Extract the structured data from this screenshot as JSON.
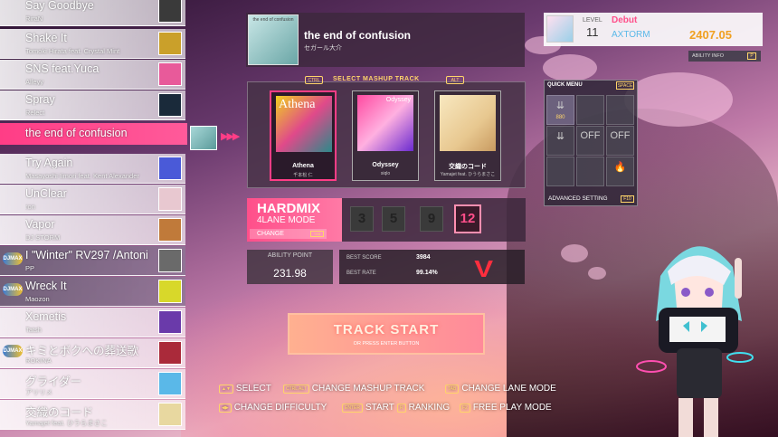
{
  "songs": [
    {
      "title": "Say Goodbye",
      "artist": "RiraN",
      "thumb": "#3a3a3a",
      "badge": ""
    },
    {
      "title": "Shake It",
      "artist": "Tomoki Hirata feat. Crystal Mint",
      "thumb": "#caa02a",
      "badge": ""
    },
    {
      "title": "SNS feat.Yuca",
      "artist": "Alleyy",
      "thumb": "#e85a9a",
      "badge": ""
    },
    {
      "title": "Spray",
      "artist": "Relect",
      "thumb": "#1a2a3a",
      "badge": ""
    },
    {
      "title": "Try Again",
      "artist": "Masayoshi Iimori feat. Kent Alexander",
      "thumb": "#4a5ad8",
      "badge": ""
    },
    {
      "title": "UnClear",
      "artist": "ron",
      "thumb": "#e8c8d0",
      "badge": ""
    },
    {
      "title": "Vapor",
      "artist": "DJ STORM",
      "thumb": "#c07a3a",
      "badge": ""
    },
    {
      "title": "I \"Winter\" RV297 /Antoni",
      "artist": "PP",
      "thumb": "#6a6a6a",
      "badge": "DJMAX"
    },
    {
      "title": "Wreck It",
      "artist": "Maozon",
      "thumb": "#d8d82a",
      "badge": "DJMAX"
    },
    {
      "title": "Xemetis",
      "artist": "Tatsh",
      "thumb": "#6a3aaa",
      "badge": ""
    },
    {
      "title": "キミとボクへの葬送歌",
      "artist": "ROKINA",
      "thumb": "#aa2a3a",
      "badge": "DJMAX"
    },
    {
      "title": "グライダー",
      "artist": "アリリメ",
      "thumb": "#5ab8e8",
      "badge": ""
    },
    {
      "title": "交織のコード",
      "artist": "Yamajet feat. ひうらまさこ",
      "thumb": "#e8d8a0",
      "badge": ""
    }
  ],
  "selected_song": {
    "title": "the end of confusion"
  },
  "top_card": {
    "title": "the end of confusion",
    "artist": "セガール大介",
    "cover_caption": "the end of confusion"
  },
  "mashup": {
    "header": "SELECT MASHUP TRACK",
    "key_left": "CTRL",
    "key_right": "ALT",
    "tracks": [
      {
        "name": "Athena",
        "sub": "千本松 仁",
        "art": "Athena"
      },
      {
        "name": "Odyssey",
        "sub": "siqlo",
        "art": "Odyssey"
      },
      {
        "name": "交織のコード",
        "sub": "Yamajet feat. ひうらまさこ",
        "art": ""
      }
    ]
  },
  "mode": {
    "title": "HARDMIX",
    "sub": "4LANE MODE",
    "change": "CHANGE",
    "change_key": "TAB",
    "lanes": [
      "3",
      "5",
      "9",
      "12"
    ]
  },
  "ability": {
    "label": "ABILITY POINT",
    "value": "231.98"
  },
  "best": {
    "score_label": "BEST SCORE",
    "score": "3984",
    "rate_label": "BEST RATE",
    "rate": "99.14%",
    "grade": "V"
  },
  "start": {
    "label": "TRACK START",
    "sub": "OR PRESS ENTER BUTTON"
  },
  "controls": [
    {
      "key": "▲▼",
      "label": "SELECT"
    },
    {
      "key": "CTRL ALT",
      "label": "CHANGE MASHUP TRACK"
    },
    {
      "key": "TAB",
      "label": "CHANGE LANE MODE"
    },
    {
      "key": "◀▶",
      "label": "CHANGE DIFFICULTY"
    },
    {
      "key": "ENTER",
      "label": "START"
    },
    {
      "key": "R",
      "label": "RANKING"
    },
    {
      "key": "F2",
      "label": "FREE PLAY MODE"
    }
  ],
  "player": {
    "level_label": "LEVEL",
    "level": "11",
    "name": "Debut",
    "title": "AXTORM",
    "rate": "2407.05",
    "ability_info": "ABILITY INFO",
    "ability_key": "P"
  },
  "quick_menu": {
    "title": "QUICK MENU",
    "key": "SPACE",
    "cells": [
      {
        "icon": "⇊",
        "value": "880"
      },
      {
        "icon": "",
        "value": ""
      },
      {
        "icon": "",
        "value": ""
      },
      {
        "icon": "⇊",
        "value": ""
      },
      {
        "icon": "OFF",
        "value": ""
      },
      {
        "icon": "OFF",
        "value": ""
      },
      {
        "icon": "",
        "value": ""
      },
      {
        "icon": "",
        "value": ""
      },
      {
        "icon": "🔥",
        "value": ""
      }
    ],
    "advanced": "ADVANCED SETTING",
    "advanced_key": "F10"
  },
  "colors": {
    "accent": "#ff3d86",
    "gold": "#ffd56a",
    "grade": "#ff2e3e"
  }
}
